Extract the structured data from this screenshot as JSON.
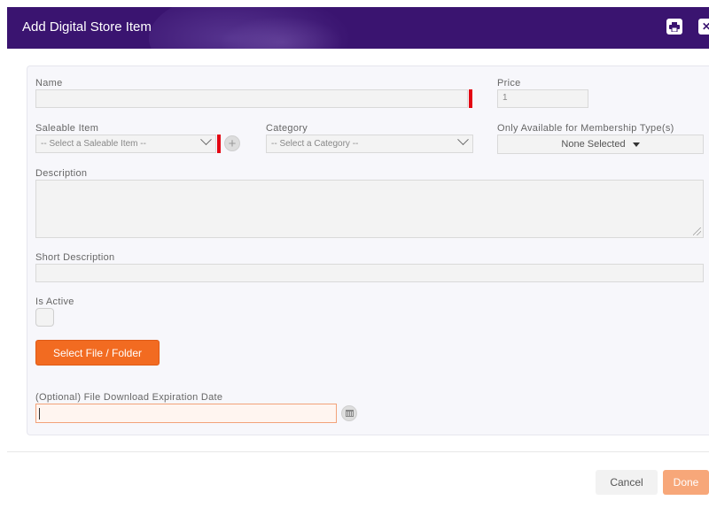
{
  "header": {
    "title": "Add Digital Store Item",
    "print_icon": "print-icon",
    "close_icon": "close-icon"
  },
  "form": {
    "name_label": "Name",
    "name_value": "",
    "price_label": "Price",
    "price_value": "1",
    "saleable_label": "Saleable Item",
    "saleable_placeholder": "-- Select a Saleable Item --",
    "category_label": "Category",
    "category_placeholder": "-- Select a Category --",
    "membership_label": "Only Available for Membership Type(s)",
    "membership_value": "None Selected",
    "description_label": "Description",
    "description_value": "",
    "short_description_label": "Short Description",
    "short_description_value": "",
    "is_active_label": "Is Active",
    "is_active": false,
    "select_file_label": "Select File / Folder",
    "expiration_label": "(Optional) File Download Expiration Date",
    "expiration_value": ""
  },
  "footer": {
    "cancel_label": "Cancel",
    "done_label": "Done"
  },
  "colors": {
    "header_bg": "#3a1470",
    "accent_orange": "#f26b21",
    "required_marker": "#e30613"
  }
}
